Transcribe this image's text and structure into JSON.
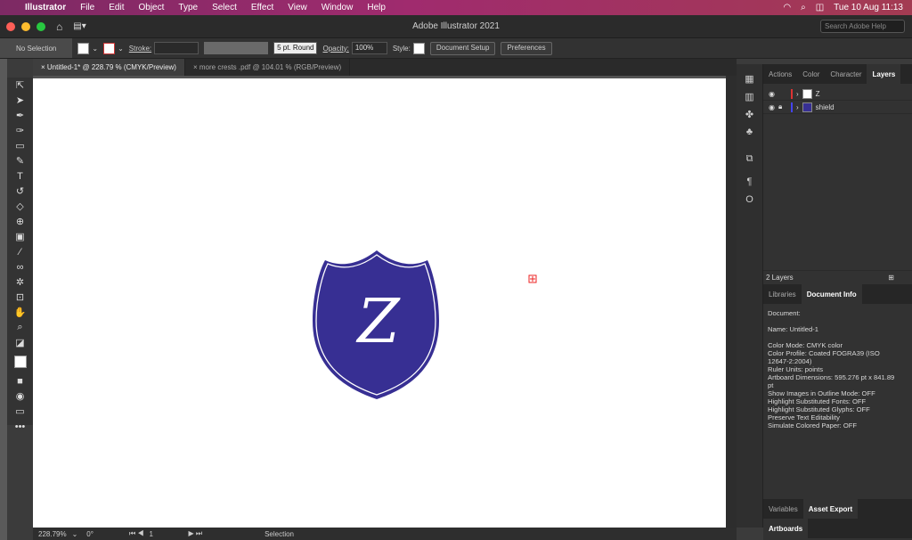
{
  "menubar": {
    "app": "Illustrator",
    "items": [
      "File",
      "Edit",
      "Object",
      "Type",
      "Select",
      "Effect",
      "View",
      "Window",
      "Help"
    ],
    "clock": "Tue 10 Aug  11:13"
  },
  "titlebar": {
    "title": "Adobe Illustrator 2021",
    "search_placeholder": "Search Adobe Help"
  },
  "control": {
    "selection": "No Selection",
    "stroke_label": "Stroke:",
    "brush": "5 pt. Round",
    "opacity_label": "Opacity:",
    "opacity_value": "100%",
    "style_label": "Style:",
    "doc_setup": "Document Setup",
    "preferences": "Preferences"
  },
  "tabs": [
    {
      "label": "Untitled-1* @ 228.79 % (CMYK/Preview)"
    },
    {
      "label": "more crests .pdf @ 104.01 % (RGB/Preview)"
    }
  ],
  "art": {
    "letter": "Z",
    "shield_color": "#372f93"
  },
  "status": {
    "zoom": "228.79%",
    "rotate": "0°",
    "artboard": "1",
    "tool": "Selection"
  },
  "panel_tabs": [
    "Actions",
    "Color",
    "Character",
    "Layers"
  ],
  "layers": [
    {
      "name": "Z",
      "color": "#d33",
      "thumb": "#ffffff"
    },
    {
      "name": "shield",
      "color": "#44e",
      "thumb": "#372f93"
    }
  ],
  "layers_count": "2 Layers",
  "info_tabs": [
    "Libraries",
    "Document Info"
  ],
  "doc_info": [
    "Document:",
    "",
    "Name: Untitled-1",
    "",
    "Color Mode: CMYK color",
    "Color Profile: Coated FOGRA39 (ISO",
    "12647-2:2004)",
    "Ruler Units: points",
    "Artboard Dimensions: 595.276 pt x 841.89",
    "pt",
    "Show Images in Outline Mode: OFF",
    "Highlight Substituted Fonts: OFF",
    "Highlight Substituted Glyphs: OFF",
    "Preserve Text Editability",
    "Simulate Colored Paper: OFF"
  ],
  "bottom_tabs": [
    "Variables",
    "Asset Export"
  ],
  "artboards_tab": "Artboards"
}
